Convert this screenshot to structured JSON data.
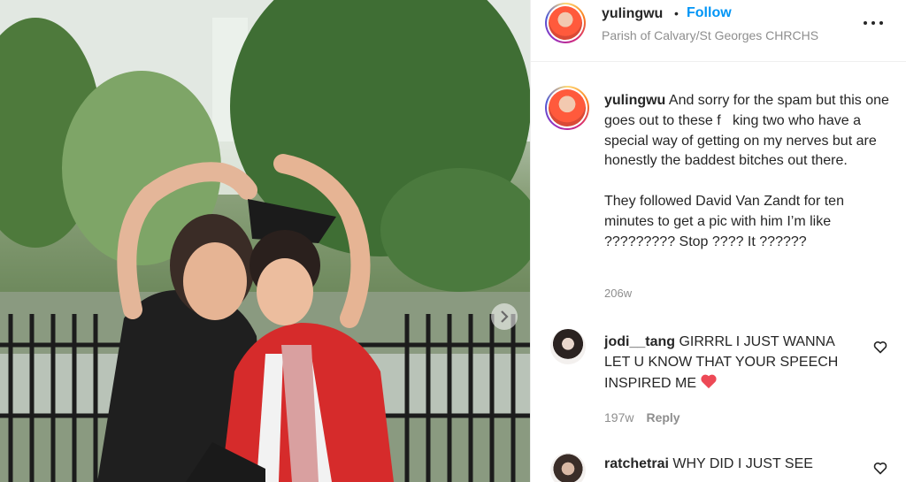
{
  "post": {
    "username": "yulingwu",
    "separator": "•",
    "follow_label": "Follow",
    "location": "Parish of Calvary/St Georges CHRCHS"
  },
  "caption": {
    "username": "yulingwu",
    "text": " And sorry for the spam but this one goes out to these f   king two who have a special way of getting on my nerves but are honestly the baddest bitches out there.",
    "text2": "They followed David Van Zandt for ten minutes to get a pic with him I’m like ????????? Stop ???? It ??????",
    "time": "206w"
  },
  "comments": [
    {
      "username": "jodi__tang",
      "text": " GIRRRL I JUST WANNA LET U KNOW THAT YOUR SPEECH INSPIRED ME ",
      "time": "197w",
      "reply_label": "Reply"
    },
    {
      "username": "ratchetrai",
      "text": " WHY DID I JUST SEE"
    }
  ],
  "colors": {
    "accent": "#0095f6",
    "muted": "#8e8e8e",
    "heart": "#ed4956"
  },
  "icons": [
    "more-options-icon",
    "heart-outline-icon",
    "red-heart-emoji",
    "chevron-right-icon"
  ]
}
